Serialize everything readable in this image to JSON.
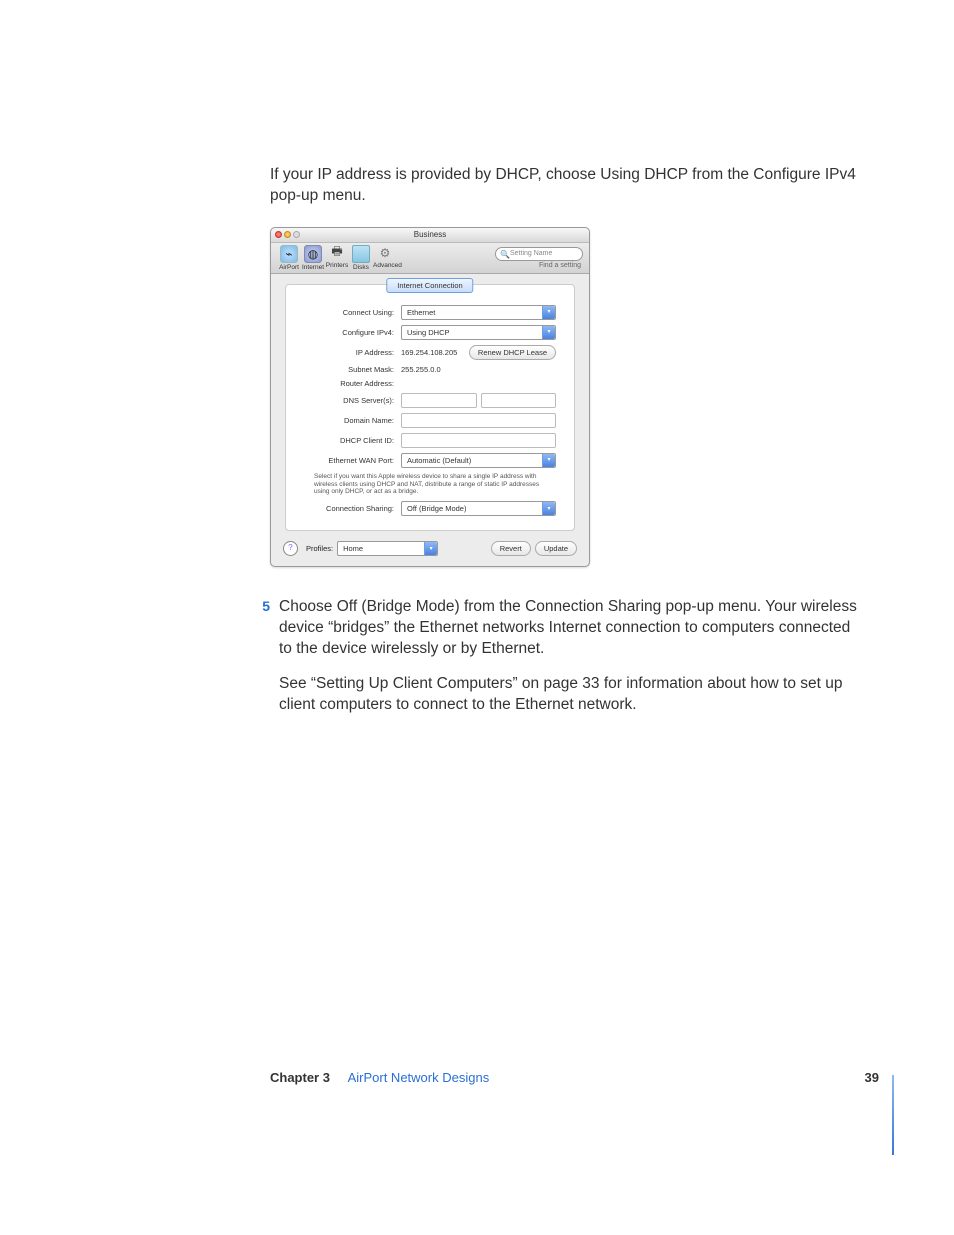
{
  "intro": "If your IP address is provided by DHCP, choose Using DHCP from the Configure IPv4 pop-up menu.",
  "step": {
    "num": "5",
    "text": "Choose Off (Bridge Mode) from the Connection Sharing pop-up menu. Your wireless device “bridges” the Ethernet networks Internet connection to computers connected to the device wirelessly or by Ethernet."
  },
  "followup": "See “Setting Up Client Computers” on page 33 for information about how to set up client computers to connect to the Ethernet network.",
  "footer": {
    "chapter": "Chapter 3",
    "title": "AirPort Network Designs",
    "page": "39"
  },
  "shot": {
    "window_title": "Business",
    "toolbar": {
      "items": [
        "AirPort",
        "Internet",
        "Printers",
        "Disks",
        "Advanced"
      ],
      "search_placeholder": "Setting Name",
      "search_hint": "Find a setting"
    },
    "tab": "Internet Connection",
    "rows": {
      "connect_using": {
        "label": "Connect Using:",
        "value": "Ethernet"
      },
      "configure_ipv4": {
        "label": "Configure IPv4:",
        "value": "Using DHCP"
      },
      "ip_address": {
        "label": "IP Address:",
        "value": "169.254.108.205"
      },
      "renew_btn": "Renew DHCP Lease",
      "subnet_mask": {
        "label": "Subnet Mask:",
        "value": "255.255.0.0"
      },
      "router_address": {
        "label": "Router Address:",
        "value": ""
      },
      "dns_servers": {
        "label": "DNS Server(s):",
        "value1": "",
        "value2": ""
      },
      "domain_name": {
        "label": "Domain Name:",
        "value": ""
      },
      "dhcp_client_id": {
        "label": "DHCP Client ID:",
        "value": ""
      },
      "wan_port": {
        "label": "Ethernet WAN Port:",
        "value": "Automatic (Default)"
      },
      "hint": "Select if you want this Apple wireless device to share a single IP address with wireless clients using DHCP and NAT, distribute a range of static IP addresses using only DHCP, or act as a bridge.",
      "connection_sharing": {
        "label": "Connection Sharing:",
        "value": "Off (Bridge Mode)"
      }
    },
    "bottom": {
      "profiles_label": "Profiles:",
      "profile_value": "Home",
      "revert": "Revert",
      "update": "Update"
    }
  }
}
